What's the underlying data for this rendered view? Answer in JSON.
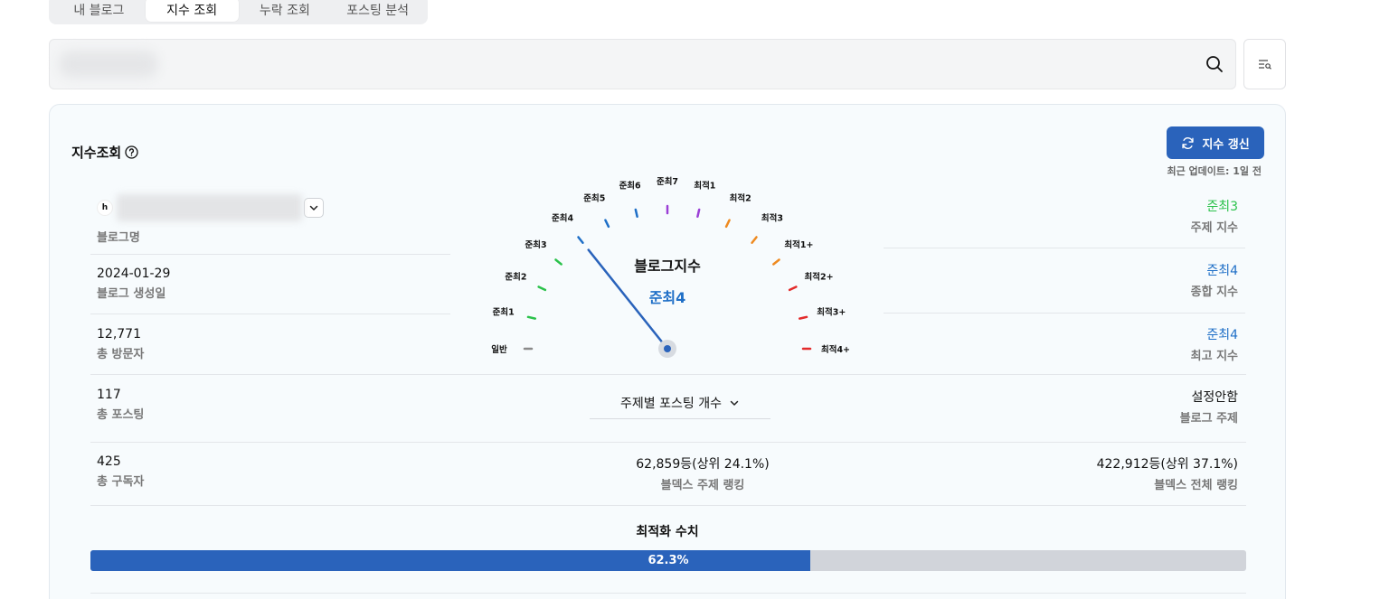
{
  "tabs": [
    {
      "label": "내 블로그",
      "active": false
    },
    {
      "label": "지수 조회",
      "active": true
    },
    {
      "label": "누락 조회",
      "active": false
    },
    {
      "label": "포스팅 분석",
      "active": false
    }
  ],
  "search": {
    "value": "",
    "placeholder": ""
  },
  "panel": {
    "title": "지수조회",
    "refresh_label": "지수 갱신",
    "updated": "최근 업데이트:  1일 전"
  },
  "colors": {
    "accent": "#2a63bb",
    "green": "#2bc24b",
    "blue": "#1f6fc7"
  },
  "left_stats": {
    "blog_name_label": "블로그명",
    "blog_logo": "h",
    "created": {
      "value": "2024-01-29",
      "label": "블로그 생성일"
    },
    "visitors": {
      "value": "12,771",
      "label": "총 방문자"
    },
    "posts": {
      "value": "117",
      "label": "총 포스팅"
    },
    "subscribers": {
      "value": "425",
      "label": "총 구독자"
    }
  },
  "right_stats": {
    "topic_index": {
      "value": "준최3",
      "label": "주제 지수"
    },
    "overall_index": {
      "value": "준최4",
      "label": "종합 지수"
    },
    "max_index": {
      "value": "준최4",
      "label": "최고 지수"
    },
    "blog_topic": {
      "value": "설정안함",
      "label": "블로그 주제"
    },
    "total_rank": {
      "value": "422,912등(상위 37.1%)",
      "label": "블덱스 전체 랭킹"
    }
  },
  "center_stats": {
    "topic_select": "주제별 포스팅 개수",
    "topic_rank": {
      "value": "62,859등(상위 24.1%)",
      "label": "블덱스 주제 랭킹"
    }
  },
  "gauge": {
    "title": "블로그지수",
    "current": "준최4",
    "current_index": 4,
    "levels": [
      {
        "label": "일반",
        "color": "#8a8a8a"
      },
      {
        "label": "준최1",
        "color": "#2bc24b"
      },
      {
        "label": "준최2",
        "color": "#2bc24b"
      },
      {
        "label": "준최3",
        "color": "#2bc24b"
      },
      {
        "label": "준최4",
        "color": "#1f6fc7"
      },
      {
        "label": "준최5",
        "color": "#1f6fc7"
      },
      {
        "label": "준최6",
        "color": "#1f6fc7"
      },
      {
        "label": "준최7",
        "color": "#9b3fd6"
      },
      {
        "label": "최적1",
        "color": "#9b3fd6"
      },
      {
        "label": "최적2",
        "color": "#ee8a20"
      },
      {
        "label": "최적3",
        "color": "#ee8a20"
      },
      {
        "label": "최적1+",
        "color": "#ee8a20"
      },
      {
        "label": "최적2+",
        "color": "#e32b2b"
      },
      {
        "label": "최적3+",
        "color": "#e32b2b"
      },
      {
        "label": "최적4+",
        "color": "#e32b2b"
      }
    ]
  },
  "optimization": {
    "title": "최적화 수치",
    "percent": 62.3,
    "label": "62.3%"
  }
}
